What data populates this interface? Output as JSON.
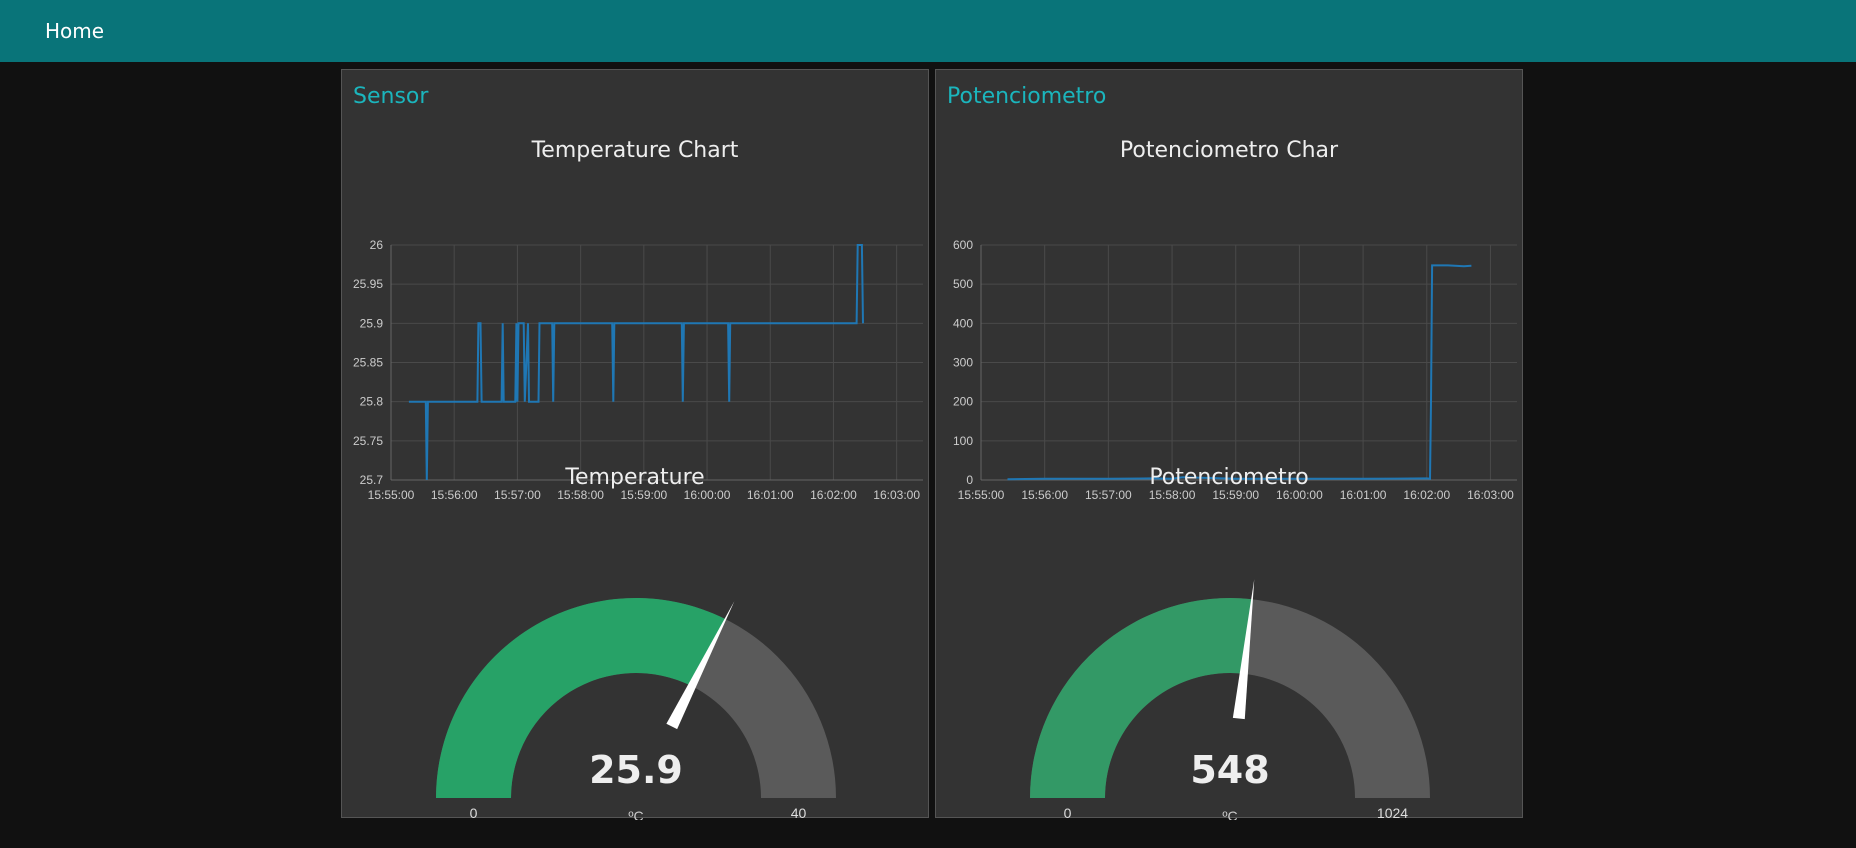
{
  "header": {
    "title": "Home"
  },
  "colors": {
    "header_bg": "#097479",
    "group_title": "#1bb5bd",
    "series_line": "#1f77b4",
    "gauge_fill_temp": "#27a267",
    "gauge_fill_pot": "#339966",
    "gauge_background": "#5a5a5a",
    "needle": "#ffffff"
  },
  "groups": [
    {
      "title": "Sensor",
      "chart": {
        "title": "Temperature Chart"
      },
      "gauge": {
        "title": "Temperature",
        "value": "25.9",
        "units": "ºC",
        "min": "0",
        "max": "40"
      }
    },
    {
      "title": "Potenciometro",
      "chart": {
        "title": "Potenciometro Char"
      },
      "gauge": {
        "title": "Potenciometro",
        "value": "548",
        "units": "ºC",
        "min": "0",
        "max": "1024"
      }
    }
  ],
  "chart_data": [
    {
      "type": "line",
      "title": "Temperature Chart",
      "xlabel": "",
      "ylabel": "",
      "x_ticks": [
        "15:55:00",
        "15:56:00",
        "15:57:00",
        "15:58:00",
        "15:59:00",
        "16:00:00",
        "16:01:00",
        "16:02:00",
        "16:03:00"
      ],
      "y_ticks": [
        "25.7",
        "25.75",
        "25.8",
        "25.85",
        "25.9",
        "25.95",
        "26"
      ],
      "xlim": [
        "15:55:00",
        "16:03:25"
      ],
      "ylim": [
        25.7,
        26.0
      ],
      "grid": true,
      "series": [
        {
          "x": [
            "15:55:17",
            "15:55:33",
            "15:55:34",
            "15:55:35",
            "15:55:36",
            "15:56:22",
            "15:56:23",
            "15:56:25",
            "15:56:26",
            "15:56:45",
            "15:56:46",
            "15:56:47",
            "15:56:58",
            "15:56:59",
            "15:57:00",
            "15:57:01",
            "15:57:06",
            "15:57:07",
            "15:57:10",
            "15:57:11",
            "15:57:20",
            "15:57:21",
            "15:57:33",
            "15:57:34",
            "15:57:35",
            "15:58:30",
            "15:58:31",
            "15:58:32",
            "15:59:36",
            "15:59:37",
            "15:59:38",
            "16:00:20",
            "16:00:21",
            "16:00:22",
            "16:02:22",
            "16:02:23",
            "16:02:27",
            "16:02:28"
          ],
          "values": [
            25.8,
            25.8,
            25.7,
            25.8,
            25.8,
            25.8,
            25.9,
            25.9,
            25.8,
            25.8,
            25.9,
            25.8,
            25.8,
            25.9,
            25.8,
            25.9,
            25.9,
            25.8,
            25.9,
            25.8,
            25.8,
            25.9,
            25.9,
            25.8,
            25.9,
            25.9,
            25.8,
            25.9,
            25.9,
            25.8,
            25.9,
            25.9,
            25.8,
            25.9,
            25.9,
            26.0,
            26.0,
            25.9
          ]
        }
      ]
    },
    {
      "type": "line",
      "title": "Potenciometro Char",
      "xlabel": "",
      "ylabel": "",
      "x_ticks": [
        "15:55:00",
        "15:56:00",
        "15:57:00",
        "15:58:00",
        "15:59:00",
        "16:00:00",
        "16:01:00",
        "16:02:00",
        "16:03:00"
      ],
      "y_ticks": [
        "0",
        "100",
        "200",
        "300",
        "400",
        "500",
        "600"
      ],
      "xlim": [
        "15:55:00",
        "16:03:25"
      ],
      "ylim": [
        0,
        600
      ],
      "grid": true,
      "series": [
        {
          "x": [
            "15:55:25",
            "15:56:00",
            "15:57:00",
            "15:57:40",
            "15:58:00",
            "15:58:10",
            "15:59:00",
            "16:00:00",
            "16:01:00",
            "16:02:00",
            "16:02:03",
            "16:02:04",
            "16:02:05",
            "16:02:20",
            "16:02:35",
            "16:02:42"
          ],
          "values": [
            2,
            3,
            3,
            4,
            3,
            7,
            3,
            3,
            3,
            4,
            3,
            200,
            548,
            548,
            546,
            547
          ]
        }
      ]
    }
  ]
}
